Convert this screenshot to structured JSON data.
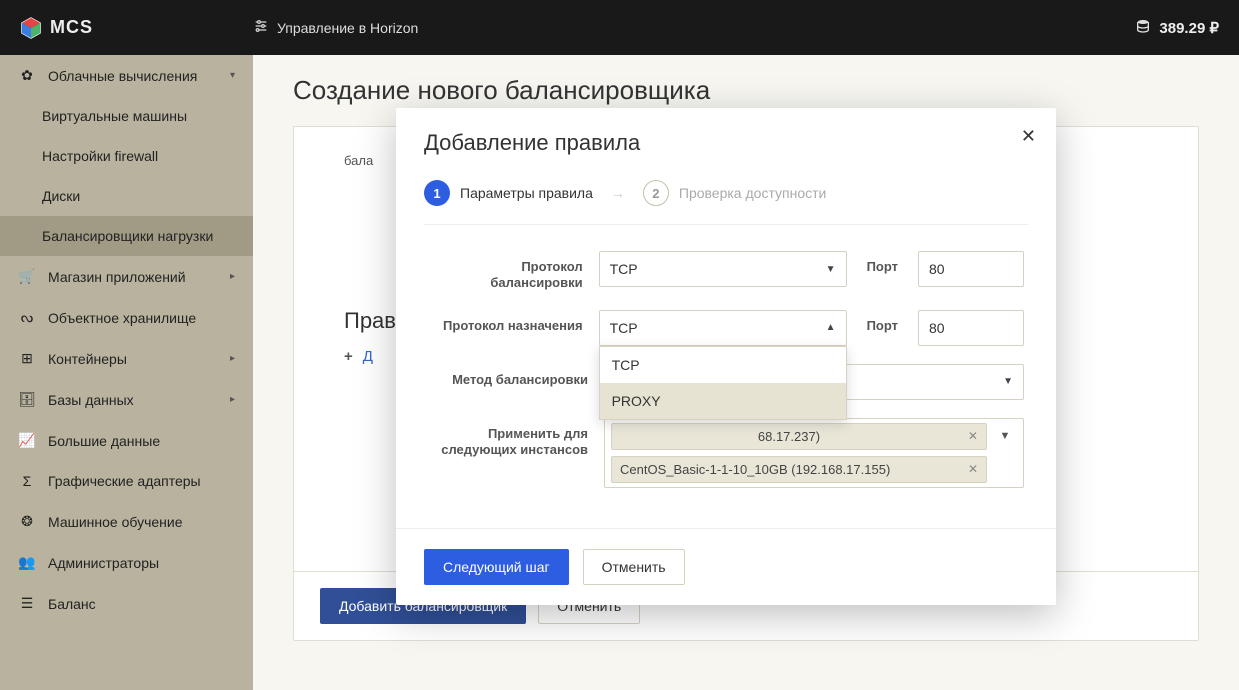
{
  "topbar": {
    "brand": "MCS",
    "horizon": "Управление в Horizon",
    "balance": "389.29 ₽"
  },
  "sidebar": {
    "items": [
      {
        "label": "Облачные вычисления"
      },
      {
        "label": "Виртуальные машины"
      },
      {
        "label": "Настройки firewall"
      },
      {
        "label": "Диски"
      },
      {
        "label": "Балансировщики нагрузки"
      },
      {
        "label": "Магазин приложений"
      },
      {
        "label": "Объектное хранилище"
      },
      {
        "label": "Контейнеры"
      },
      {
        "label": "Базы данных"
      },
      {
        "label": "Большие данные"
      },
      {
        "label": "Графические адаптеры"
      },
      {
        "label": "Машинное обучение"
      },
      {
        "label": "Администраторы"
      },
      {
        "label": "Баланс"
      }
    ]
  },
  "page": {
    "title": "Создание нового балансировщика",
    "partial": "бала",
    "rules_title": "Правил",
    "add_rule": "Д",
    "bottom": {
      "primary": "Добавить балансировщик",
      "secondary": "Отменить"
    }
  },
  "modal": {
    "title": "Добавление правила",
    "step1": "Параметры правила",
    "step2": "Проверка доступности",
    "labels": {
      "proto_bal": "Протокол балансировки",
      "proto_dest": "Протокол назначения",
      "method": "Метод балансировки",
      "instances": "Применить для следующих инстансов",
      "port": "Порт"
    },
    "values": {
      "proto_bal": "TCP",
      "port1": "80",
      "proto_dest": "TCP",
      "port2": "80",
      "method": "",
      "chip1_partial": "68.17.237)",
      "chip2": "CentOS_Basic-1-1-10_10GB (192.168.17.155)"
    },
    "dropdown": {
      "opt1": "TCP",
      "opt2": "PROXY"
    },
    "actions": {
      "next": "Следующий шаг",
      "cancel": "Отменить"
    }
  }
}
